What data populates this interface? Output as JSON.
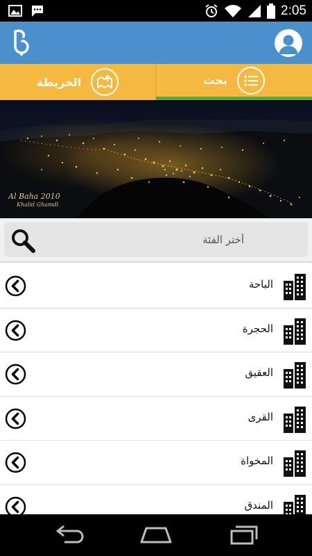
{
  "status_bar": {
    "time": "2:05",
    "left_icons": [
      "image-notification-icon",
      "chat-notification-icon"
    ],
    "right_icons": [
      "alarm-icon",
      "wifi-icon",
      "signal-icon",
      "battery-icon"
    ]
  },
  "app_bar": {
    "logo_icon": "app-logo",
    "profile_icon": "profile-icon",
    "color": "#4a90cc"
  },
  "tabs": [
    {
      "label": "الخريطة",
      "icon": "map-icon",
      "active": false
    },
    {
      "label": "بحث",
      "icon": "list-icon",
      "active": true
    }
  ],
  "hero": {
    "caption_line1": "Al Baha 2010",
    "caption_line2": "Khalid Ghamdi"
  },
  "search": {
    "placeholder": "أختر الفئة",
    "value": ""
  },
  "categories": [
    {
      "label": "الباحة"
    },
    {
      "label": "الحجرة"
    },
    {
      "label": "العقيق"
    },
    {
      "label": "القرى"
    },
    {
      "label": "المخواة"
    },
    {
      "label": "المندق"
    }
  ],
  "colors": {
    "tab_background": "#f5b942",
    "active_tab_indicator": "#46b04a",
    "app_bar": "#4a90cc"
  },
  "nav_bar": {
    "buttons": [
      "back-icon",
      "home-icon",
      "recent-apps-icon"
    ]
  }
}
